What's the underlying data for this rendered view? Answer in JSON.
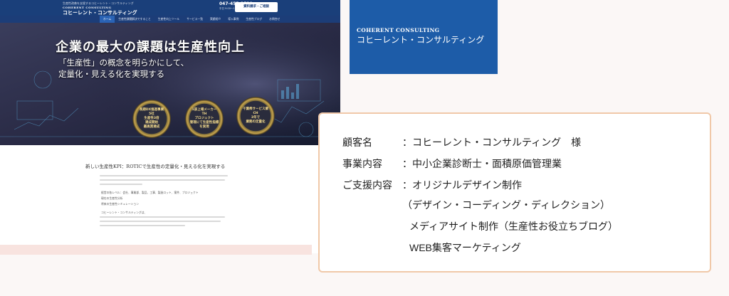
{
  "site": {
    "header": {
      "tagline": "生産性改善を支援するコヒーレント・コンサルティング",
      "logo_en": "COHERENT CONSULTING",
      "logo_jp": "コヒーレント・コンサルティング",
      "tel": "047-455-3510",
      "hours": "平日 9:00〜18:00",
      "contact_button": "資料請求・ご相談"
    },
    "nav": [
      "ホーム",
      "生産性課題解決ですること",
      "生産性向上ツール",
      "サービス一覧",
      "実績紹介",
      "導入事例",
      "生産性ブログ",
      "お問合せ"
    ],
    "hero": {
      "title": "企業の最大の課題は生産性向上",
      "sub1": "「生産性」の概念を明らかにして、",
      "sub2": "定量化・見える化を実現する",
      "badges": [
        [
          "長期DX推進事業",
          "5社",
          "生産性3倍",
          "達成開始",
          "最高賞達成"
        ],
        [
          "1部上場メーカー",
          "TH",
          "プロジェクト",
          "管理にて生産性指標",
          "を実現"
        ],
        [
          "千葉県サービス業",
          "CH",
          "3年で",
          "業務の定量化"
        ]
      ]
    },
    "content": {
      "title": "新しい生産性KPI：ROTICで生産性の定量化・見える化を実現する",
      "bullets": [
        "経営の各レベル：会社、事業部、製品、工事、製造ロット、案件、プロジェクト",
        "現在の生産性分析",
        "将来の生産性シミュレーション"
      ],
      "footer_text": "コヒーレント・コンサルティングは、"
    }
  },
  "logo_card": {
    "en": "COHERENT CONSULTING",
    "jp": "コヒーレント・コンサルティング"
  },
  "info": {
    "colon": "：",
    "client_label": "顧客名",
    "client_value": "コヒーレント・コンサルティング　様",
    "business_label": "事業内容",
    "business_value": "中小企業診断士・面積原価管理業",
    "support_label": "ご支援内容",
    "support_values": [
      "オリジナルデザイン制作",
      "（デザイン・コーディング・ディレクション）",
      "メディアサイト制作（生産性お役立ちブログ）",
      "WEB集客マーケティング"
    ]
  },
  "colors": {
    "brand_blue": "#1d5ca8",
    "header_blue": "#1a3f7a",
    "box_border": "#f0c8a8",
    "page_bg": "#fbf7f6"
  }
}
